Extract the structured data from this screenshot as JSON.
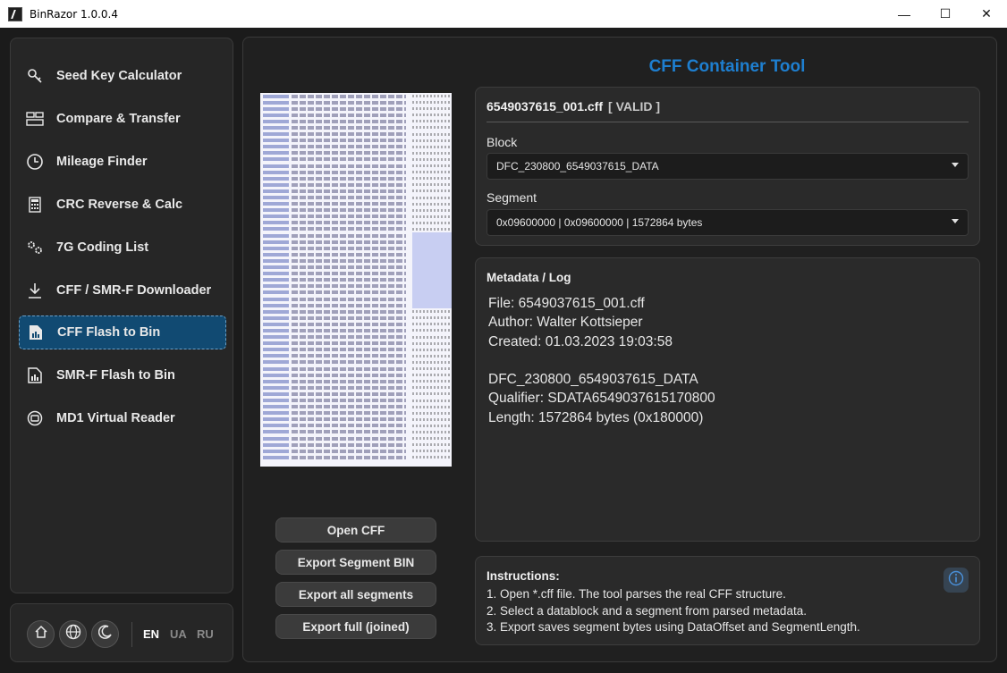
{
  "window": {
    "title": "BinRazor 1.0.0.4",
    "minimize": "—",
    "maximize": "☐",
    "close": "✕"
  },
  "sidebar": {
    "items": [
      {
        "label": "Seed Key Calculator",
        "icon": "key-icon"
      },
      {
        "label": "Compare & Transfer",
        "icon": "compare-icon"
      },
      {
        "label": "Mileage Finder",
        "icon": "clock-icon"
      },
      {
        "label": "CRC Reverse & Calc",
        "icon": "calculator-icon"
      },
      {
        "label": "7G Coding List",
        "icon": "gears-icon"
      },
      {
        "label": "CFF / SMR-F Downloader",
        "icon": "download-icon"
      },
      {
        "label": "CFF Flash to Bin",
        "icon": "file-chart-icon",
        "active": true
      },
      {
        "label": "SMR-F Flash to Bin",
        "icon": "file-bar-icon"
      },
      {
        "label": "MD1 Virtual Reader",
        "icon": "chip-icon"
      }
    ]
  },
  "bottom": {
    "languages": [
      "EN",
      "UA",
      "RU"
    ],
    "active_language": "EN"
  },
  "main": {
    "title": "CFF Container Tool",
    "buttons": {
      "open": "Open CFF",
      "export_segment": "Export Segment BIN",
      "export_all": "Export all segments",
      "export_full": "Export full (joined)"
    },
    "file": {
      "name": "6549037615_001.cff",
      "status": "[ VALID ]",
      "block_label": "Block",
      "block_value": "DFC_230800_6549037615_DATA",
      "segment_label": "Segment",
      "segment_value": "0x09600000 | 0x09600000 | 1572864 bytes"
    },
    "metadata": {
      "title": "Metadata / Log",
      "lines": [
        "File: 6549037615_001.cff",
        "Author: Walter Kottsieper",
        "Created: 01.03.2023 19:03:58",
        "",
        "DFC_230800_6549037615_DATA",
        "Qualifier: SDATA6549037615170800",
        "Length: 1572864 bytes (0x180000)"
      ]
    },
    "instructions": {
      "title": "Instructions:",
      "lines": [
        "1. Open *.cff file. The tool parses the real CFF structure.",
        "2. Select a datablock and a segment from parsed metadata.",
        "3. Export saves segment bytes using DataOffset and SegmentLength."
      ]
    }
  },
  "colors": {
    "accent": "#1e7fd0",
    "active_nav": "#114a72"
  }
}
